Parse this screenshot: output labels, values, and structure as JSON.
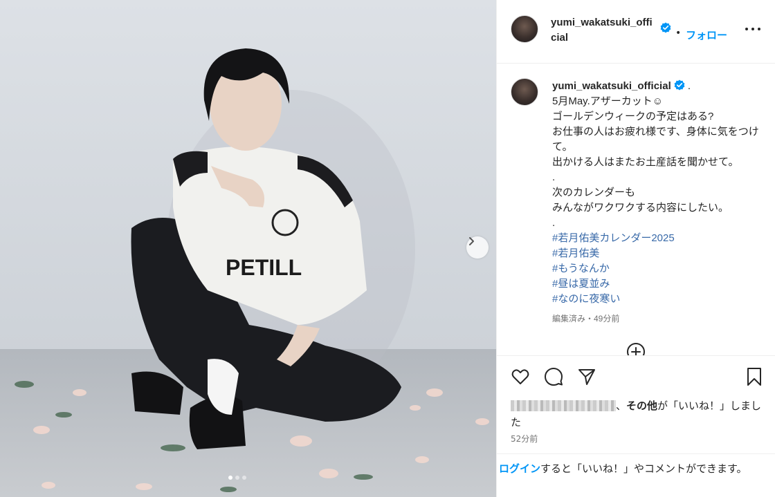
{
  "post": {
    "photo_alt": "Photo of a person with short dark hair in a white jersey sitting on the floor",
    "carousel_dots": 3,
    "active_dot": 0
  },
  "header": {
    "username": "yumi_wakatsuki_official",
    "separator": "•",
    "follow_label": "フォロー"
  },
  "caption": {
    "username": "yumi_wakatsuki_official",
    "lines": [
      "5月May.アザーカット☺",
      "ゴールデンウィークの予定はある?",
      "お仕事の人はお疲れ様です、身体に気をつけて。",
      "出かける人はまたお土産話を聞かせて。",
      ".",
      "次のカレンダーも",
      "みんながワクワクする内容にしたい。",
      "."
    ],
    "hashtags": [
      "#若月佑美カレンダー2025",
      "#若月佑美",
      "#もうなんか",
      "#昼は夏並み",
      "#なのに夜寒い"
    ],
    "meta": "編集済み・49分前"
  },
  "likes": {
    "suffix_bold": "その他",
    "suffix_text": "が「いいね！」しました"
  },
  "timestamp": "52分前",
  "login_prompt": {
    "link": "ログイン",
    "text": "すると「いいね！」やコメントができます。"
  },
  "colors": {
    "accent": "#0095f6",
    "hashtag": "#3869a8",
    "verified": "#0095f6",
    "muted": "#737373"
  },
  "icons": [
    "chevron-right-icon",
    "verified-badge-icon",
    "more-icon",
    "add-comment-icon",
    "heart-icon",
    "comment-icon",
    "share-icon",
    "bookmark-icon"
  ]
}
